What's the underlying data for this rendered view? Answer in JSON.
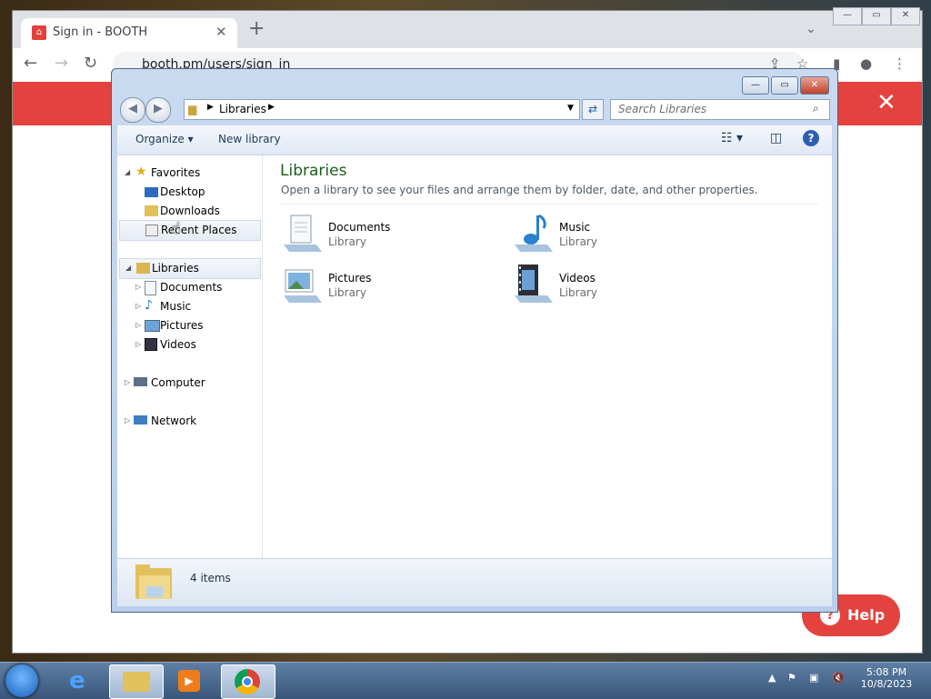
{
  "browser": {
    "tab_title": "Sign in - BOOTH",
    "url": "booth.pm/users/sign_in",
    "help_label": "Help"
  },
  "explorer": {
    "address_crumb": "Libraries",
    "search_placeholder": "Search Libraries",
    "commands": {
      "organize": "Organize",
      "new_library": "New library"
    },
    "nav": {
      "favorites": "Favorites",
      "desktop": "Desktop",
      "downloads": "Downloads",
      "recent_places": "Recent Places",
      "libraries": "Libraries",
      "documents": "Documents",
      "music": "Music",
      "pictures": "Pictures",
      "videos": "Videos",
      "computer": "Computer",
      "network": "Network"
    },
    "content": {
      "title": "Libraries",
      "subtitle": "Open a library to see your files and arrange them by folder, date, and other properties.",
      "items": [
        {
          "name": "Documents",
          "type": "Library"
        },
        {
          "name": "Music",
          "type": "Library"
        },
        {
          "name": "Pictures",
          "type": "Library"
        },
        {
          "name": "Videos",
          "type": "Library"
        }
      ]
    },
    "status": {
      "count": "4 items"
    }
  },
  "taskbar": {
    "time": "5:08 PM",
    "date": "10/8/2023"
  },
  "colors": {
    "accent": "#e4423f",
    "explorer_title": "#1e5c1e"
  }
}
